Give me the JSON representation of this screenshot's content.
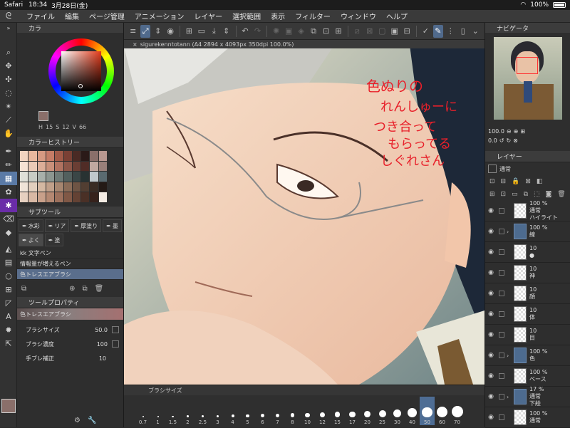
{
  "status": {
    "app": "Safari",
    "time": "18:34",
    "date": "3月28日(金)",
    "battery": "100%"
  },
  "menu": [
    "ファイル",
    "編集",
    "ページ管理",
    "アニメーション",
    "レイヤー",
    "選択範囲",
    "表示",
    "フィルター",
    "ウィンドウ",
    "ヘルプ"
  ],
  "color_panel": {
    "title": "カラ",
    "h": "15",
    "s": "12",
    "v": "66",
    "h_label": "H",
    "s_label": "S",
    "v_label": "V"
  },
  "color_history": {
    "title": "カラーヒストリー"
  },
  "subtool": {
    "title": "サブツール",
    "tabs": [
      "水彩",
      "リア",
      "厚塗り",
      "墨",
      "よく",
      "塗"
    ],
    "items": [
      "kk 文字ペン",
      "情報量が増えるペン",
      "色トレスエアブラシ"
    ]
  },
  "tool_property": {
    "title": "ツールプロパティ",
    "tool_name": "色トレスエアブラシ",
    "brush_size_label": "ブラシサイズ",
    "brush_size": "50.0",
    "density_label": "ブラシ濃度",
    "density": "100",
    "stabilize_label": "手ブレ補正",
    "stabilize": "10"
  },
  "canvas": {
    "tab": "sigurekenntotann (A4 2894 x 4093px 350dpi 100.0%)",
    "handwriting": [
      "色ぬりの",
      "れんしゅーに",
      "つき合って",
      "もらってる",
      "しぐれさん"
    ]
  },
  "brush_bar": {
    "title": "ブラシサイズ",
    "sizes": [
      "0.7",
      "1",
      "1.5",
      "2",
      "2.5",
      "3",
      "4",
      "5",
      "6",
      "7",
      "8",
      "10",
      "12",
      "15",
      "17",
      "20",
      "25",
      "30",
      "40",
      "50",
      "60",
      "70"
    ],
    "selected": "50"
  },
  "navigator": {
    "title": "ナビゲータ",
    "zoom": "100.0",
    "rotation": "0.0"
  },
  "layers": {
    "title": "レイヤー",
    "blend": "通常",
    "items": [
      {
        "opacity": "100 %",
        "mode": "通常",
        "name": "ハイライト",
        "kind": "layer"
      },
      {
        "opacity": "100 %",
        "mode": "",
        "name": "線",
        "kind": "folder"
      },
      {
        "opacity": "10",
        "mode": "",
        "name": "●",
        "kind": "layer"
      },
      {
        "opacity": "10",
        "mode": "",
        "name": "神",
        "kind": "layer"
      },
      {
        "opacity": "10",
        "mode": "",
        "name": "顔",
        "kind": "layer"
      },
      {
        "opacity": "10",
        "mode": "",
        "name": "体",
        "kind": "layer"
      },
      {
        "opacity": "10",
        "mode": "",
        "name": "目",
        "kind": "layer"
      },
      {
        "opacity": "100 %",
        "mode": "",
        "name": "色",
        "kind": "folder"
      },
      {
        "opacity": "100 %",
        "mode": "",
        "name": "ベース",
        "kind": "layer"
      },
      {
        "opacity": "17 %",
        "mode": "通常",
        "name": "下絵",
        "kind": "folder"
      },
      {
        "opacity": "100 %",
        "mode": "通常",
        "name": "",
        "kind": "layer"
      }
    ]
  },
  "colors": {
    "accent": "#5a7aa6",
    "panel": "#2e2e2e",
    "handwriting": "#e8202a"
  }
}
